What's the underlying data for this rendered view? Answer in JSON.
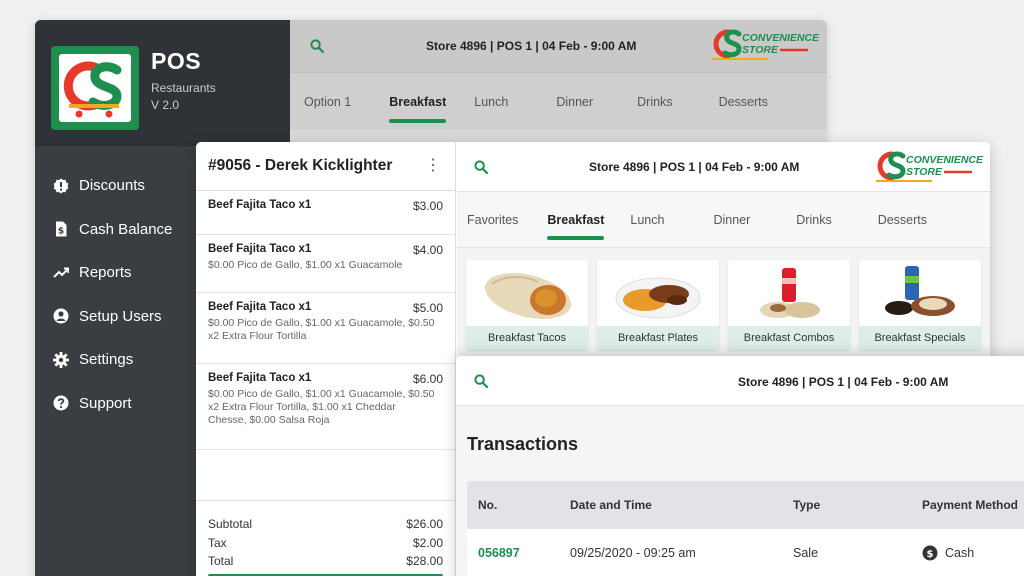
{
  "app": {
    "title": "POS",
    "subtitle": "Restaurants",
    "version": "V 2.0"
  },
  "brand": {
    "logo_line1": "CONVENIENCE",
    "logo_line2": "STORE",
    "green": "#1e8f4f",
    "red": "#e53a2a",
    "orange": "#f5a623"
  },
  "sidebar": {
    "items": [
      {
        "label": "Discounts",
        "icon": "alert-badge-icon"
      },
      {
        "label": "Cash Balance",
        "icon": "money-receipt-icon"
      },
      {
        "label": "Reports",
        "icon": "trend-icon"
      },
      {
        "label": "Setup Users",
        "icon": "user-circle-icon"
      },
      {
        "label": "Settings",
        "icon": "gear-icon"
      },
      {
        "label": "Support",
        "icon": "help-icon"
      }
    ]
  },
  "header": {
    "store_line": "Store 4896 | POS 1 | 04 Feb - 9:00 AM"
  },
  "back_tabs": [
    "Option 1",
    "Breakfast",
    "Lunch",
    "Dinner",
    "Drinks",
    "Desserts"
  ],
  "menu_tabs": [
    "Favorites",
    "Breakfast",
    "Lunch",
    "Dinner",
    "Drinks",
    "Desserts"
  ],
  "active_tab": "Breakfast",
  "order": {
    "title": "#9056 - Derek Kicklighter",
    "items": [
      {
        "name": "Beef Fajita Taco x1",
        "price": "$3.00",
        "mods": ""
      },
      {
        "name": "Beef Fajita Taco x1",
        "price": "$4.00",
        "mods": "$0.00 Pico de Gallo, $1.00 x1 Guacamole"
      },
      {
        "name": "Beef Fajita Taco x1",
        "price": "$5.00",
        "mods": "$0.00 Pico de Gallo, $1.00 x1 Guacamole, $0.50 x2 Extra Flour Tortilla"
      },
      {
        "name": "Beef Fajita Taco x1",
        "price": "$6.00",
        "mods": "$0.00 Pico de Gallo, $1.00 x1 Guacamole, $0.50 x2 Extra Flour Tortilla, $1.00 x1 Cheddar Chesse, $0.00 Salsa Roja"
      }
    ],
    "subtotal_label": "Subtotal",
    "subtotal": "$26.00",
    "tax_label": "Tax",
    "tax": "$2.00",
    "total_label": "Total",
    "total": "$28.00"
  },
  "categories": [
    {
      "label": "Breakfast Tacos",
      "image": "burrito-image"
    },
    {
      "label": "Breakfast Plates",
      "image": "plate-image"
    },
    {
      "label": "Breakfast Combos",
      "image": "combo-image"
    },
    {
      "label": "Breakfast Specials",
      "image": "specials-image"
    }
  ],
  "transactions": {
    "title": "Transactions",
    "columns": [
      "No.",
      "Date and Time",
      "Type",
      "Payment Method"
    ],
    "rows": [
      {
        "no": "056897",
        "datetime": "09/25/2020 - 09:25 am",
        "type": "Sale",
        "method": "Cash"
      }
    ]
  }
}
